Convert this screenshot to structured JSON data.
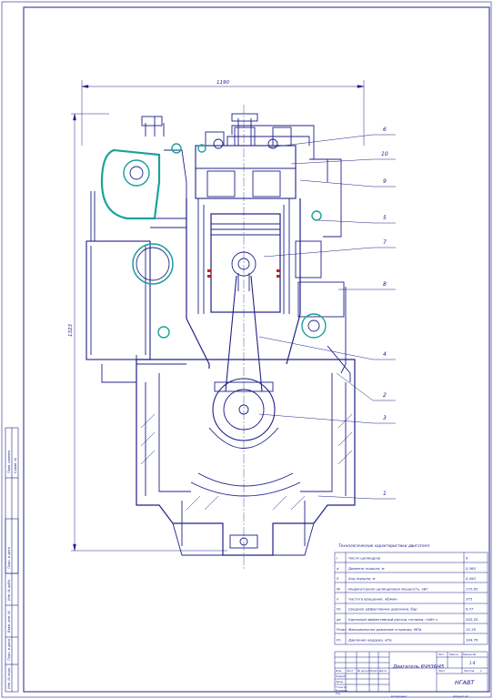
{
  "drawing": {
    "dim_width": "1190",
    "dim_height": "1323",
    "callouts": [
      "6",
      "10",
      "9",
      "5",
      "7",
      "8",
      "4",
      "2",
      "3",
      "1"
    ]
  },
  "spec_table": {
    "title": "Технологические характеристики двигателя",
    "rows": [
      {
        "sym": "i",
        "name": "Число цилиндров",
        "value": "6"
      },
      {
        "sym": "d",
        "name": "Диаметр поршня, м",
        "value": "0,360"
      },
      {
        "sym": "S",
        "name": "Ход поршня, м",
        "value": "0,450"
      },
      {
        "sym": "Ni",
        "name": "Индикаторная цилиндровая мощность, кВт",
        "value": "172,65"
      },
      {
        "sym": "n",
        "name": "Частота вращения, об/мин",
        "value": "375"
      },
      {
        "sym": "Pe",
        "name": "Среднее эффективное давление, бар",
        "value": "9,77"
      },
      {
        "sym": "ge",
        "name": "Удельный эффективный расход топлива, г/кВт·ч",
        "value": "202,20"
      },
      {
        "sym": "Pmax",
        "name": "Максимальное давление сгорания, МПа",
        "value": "12,19"
      },
      {
        "sym": "Pn",
        "name": "Давление наддува, кПа",
        "value": "184,79"
      }
    ]
  },
  "title_block": {
    "designation": "Двигатель 6ЧН36/45",
    "org": "НГАВТ",
    "sheet_label": "Лит.",
    "mass_label": "Масса",
    "scale_label": "Масштаб",
    "scale_value": "1:4",
    "sheet_no": "Лист",
    "sheets_label": "Листов",
    "sheets_value": "1",
    "row_labels": [
      "Изм.",
      "Лист",
      "№ докум.",
      "Подп.",
      "Дата"
    ],
    "role_labels": [
      "Разраб.",
      "Пров.",
      "Т.контр.",
      "Н.контр.",
      "Утв."
    ],
    "copied": "Копировал",
    "format": "Формат А1"
  },
  "left_strip": {
    "labels": [
      "Перв. примен.",
      "Справ. №",
      "Подп. и дата",
      "Инв. № дубл.",
      "Взам. инв. №",
      "Подп. и дата",
      "Инв. № подл."
    ]
  }
}
